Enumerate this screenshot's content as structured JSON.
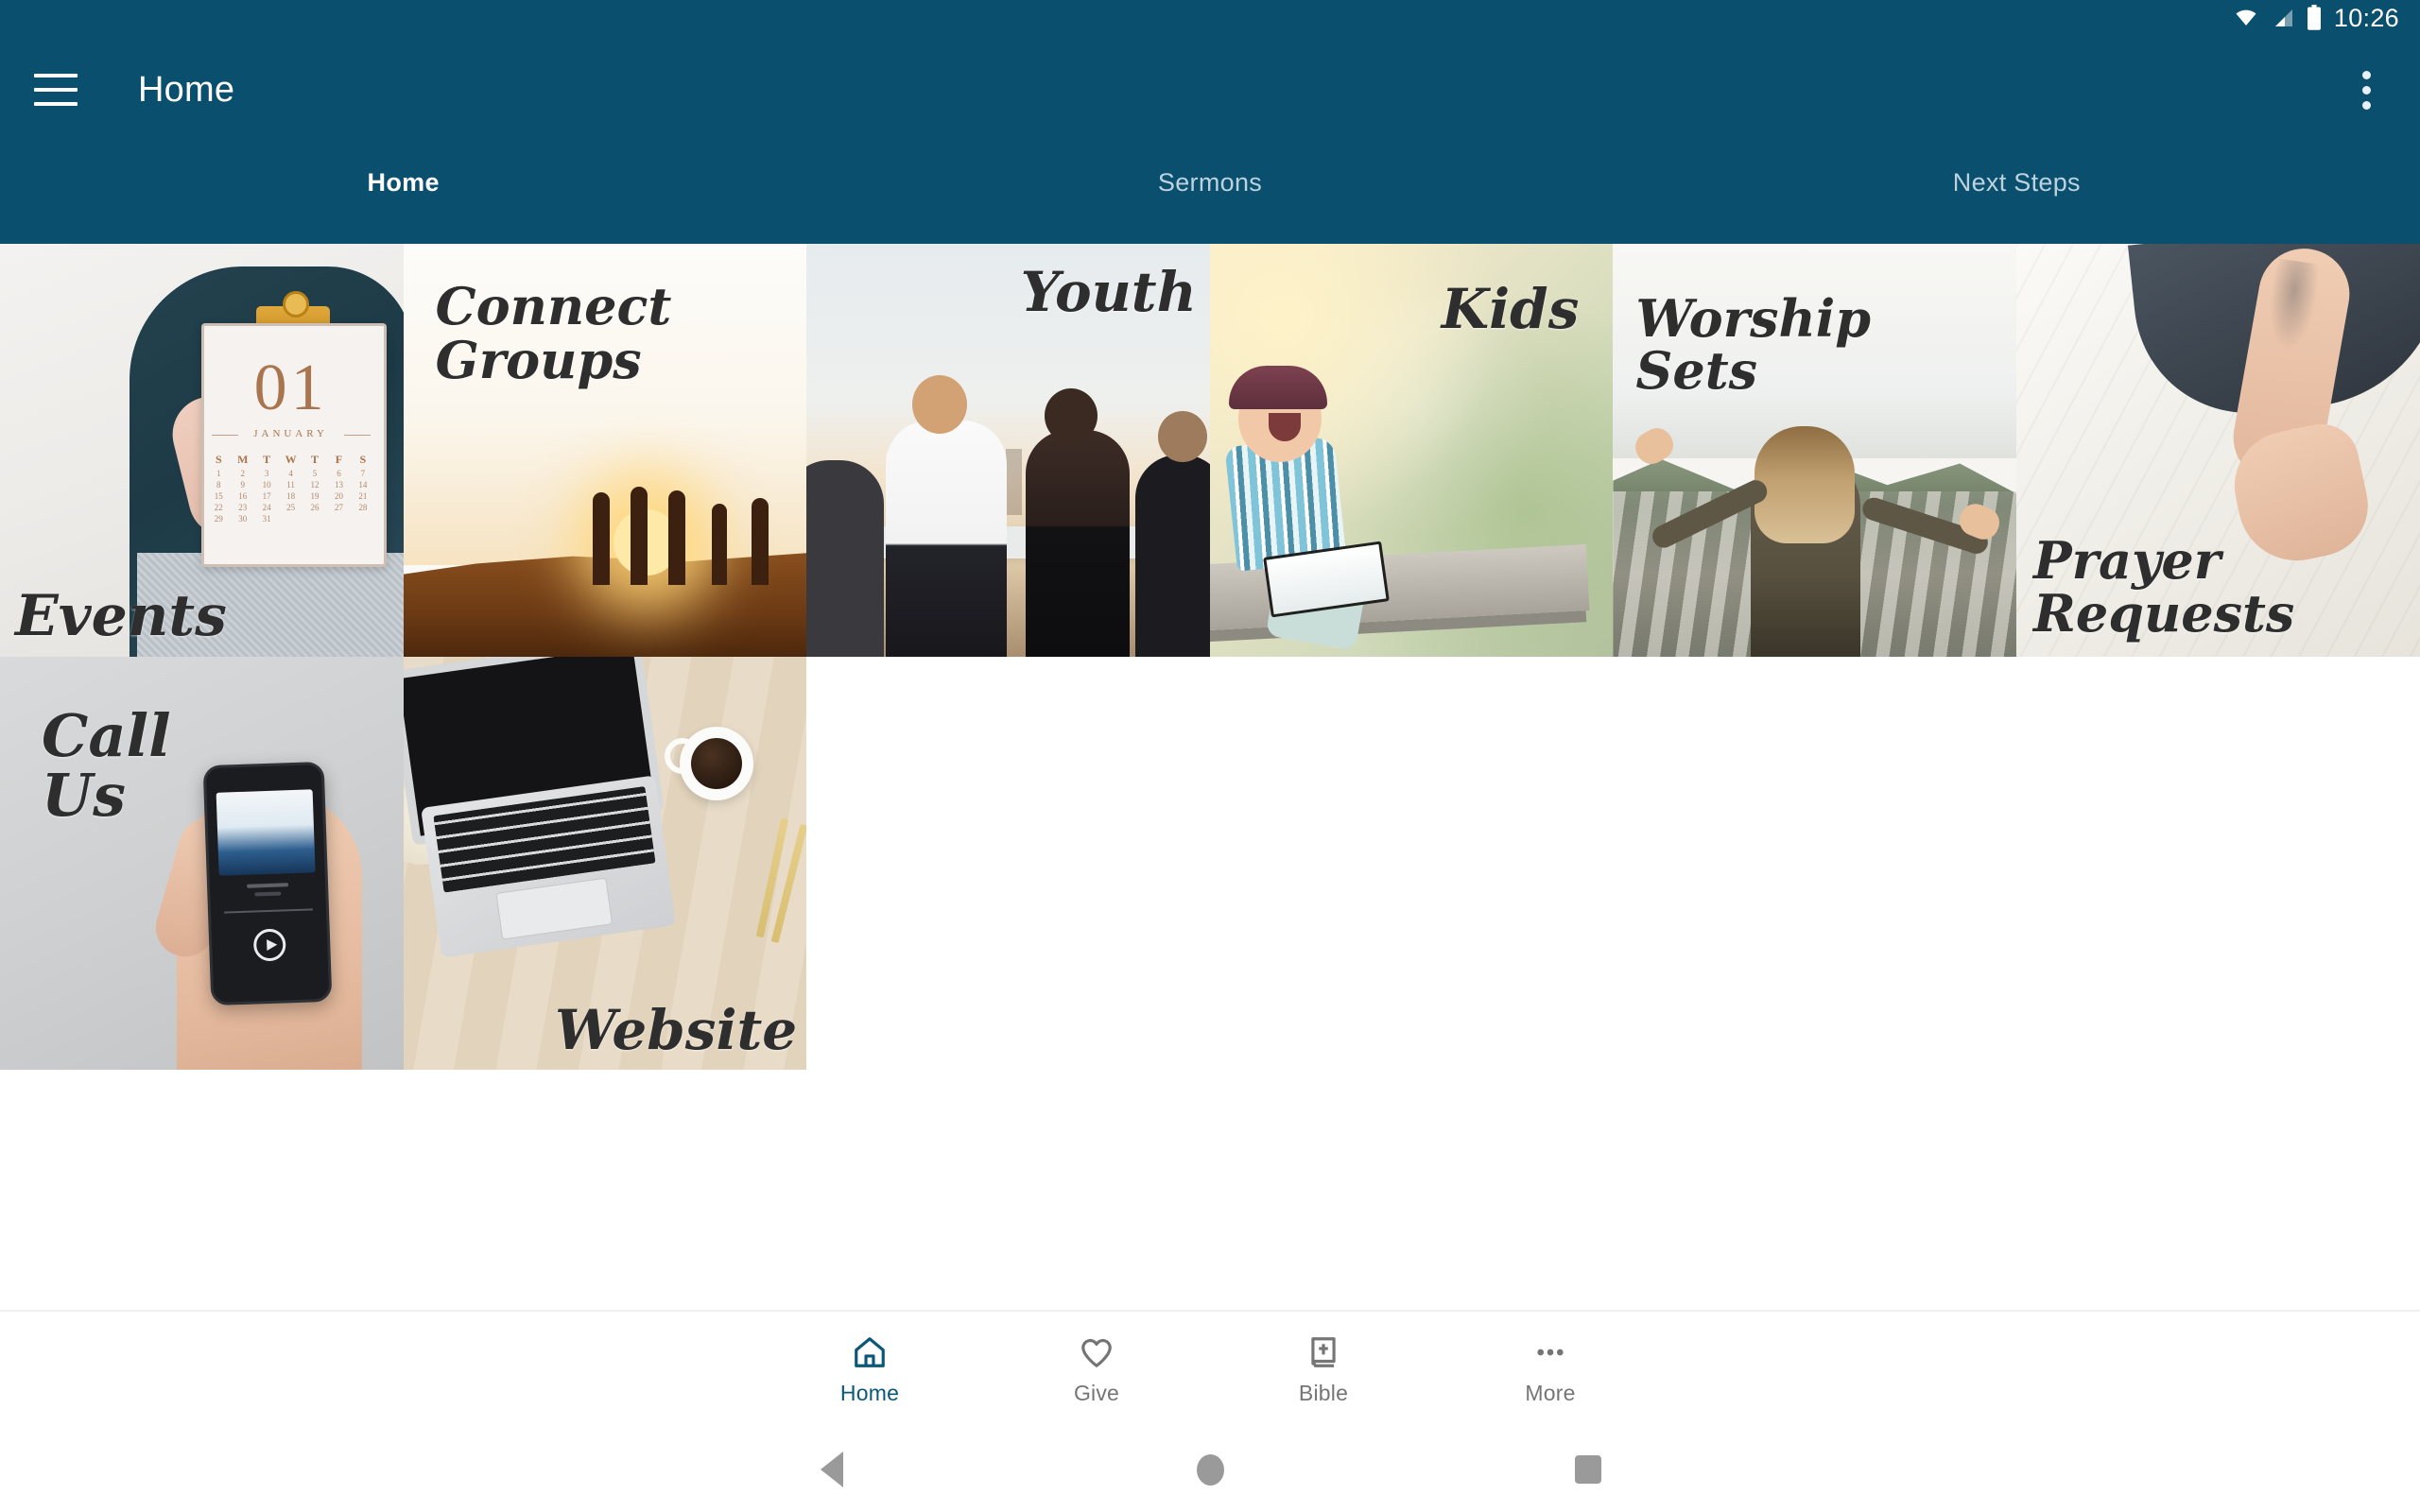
{
  "status_bar": {
    "time": "10:26",
    "icons": [
      "wifi-icon",
      "cellular-signal-icon",
      "battery-icon"
    ]
  },
  "app_bar": {
    "menu_icon": "hamburger-menu-icon",
    "title": "Home",
    "overflow_icon": "overflow-menu-icon"
  },
  "tabs": [
    {
      "label": "Home",
      "active": true
    },
    {
      "label": "Sermons",
      "active": false
    },
    {
      "label": "Next Steps",
      "active": false
    }
  ],
  "tiles": [
    {
      "label": "Events",
      "image": "woman-holding-january-calendar-clipboard"
    },
    {
      "label": "Connect\nGroups",
      "image": "group-silhouettes-at-sunset"
    },
    {
      "label": "Youth",
      "image": "teens-looking-at-city-skyline"
    },
    {
      "label": "Kids",
      "image": "laughing-boy-with-bible-on-bench"
    },
    {
      "label": "Worship\nSets",
      "image": "woman-arms-outstretched-over-canyon"
    },
    {
      "label": "Prayer\nRequests",
      "image": "open-hand-on-white-bedsheet"
    },
    {
      "label": "Call\nUs",
      "image": "hand-holding-phone-music-player"
    },
    {
      "label": "Website",
      "image": "laptop-coffee-pencils-on-desk"
    }
  ],
  "events_tile": {
    "day_number": "01",
    "month": "JANUARY",
    "weekday_initials": [
      "S",
      "M",
      "T",
      "W",
      "T",
      "F",
      "S"
    ],
    "days": [
      "1",
      "2",
      "3",
      "4",
      "5",
      "6",
      "7",
      "8",
      "9",
      "10",
      "11",
      "12",
      "13",
      "14",
      "15",
      "16",
      "17",
      "18",
      "19",
      "20",
      "21",
      "22",
      "23",
      "24",
      "25",
      "26",
      "27",
      "28",
      "29",
      "30",
      "31"
    ]
  },
  "bottom_nav": [
    {
      "label": "Home",
      "icon": "house-icon",
      "active": true
    },
    {
      "label": "Give",
      "icon": "heart-icon",
      "active": false
    },
    {
      "label": "Bible",
      "icon": "bible-book-icon",
      "active": false
    },
    {
      "label": "More",
      "icon": "ellipsis-icon",
      "active": false
    }
  ],
  "system_nav": [
    {
      "name": "back",
      "icon": "triangle-back-icon"
    },
    {
      "name": "home",
      "icon": "circle-home-icon"
    },
    {
      "name": "recent",
      "icon": "square-recents-icon"
    }
  ],
  "colors": {
    "brand_primary": "#0a4f6e",
    "nav_active": "#0a5779",
    "nav_inactive": "#757575",
    "tab_inactive": "#bcd3de",
    "page_bg": "#ffffff"
  }
}
